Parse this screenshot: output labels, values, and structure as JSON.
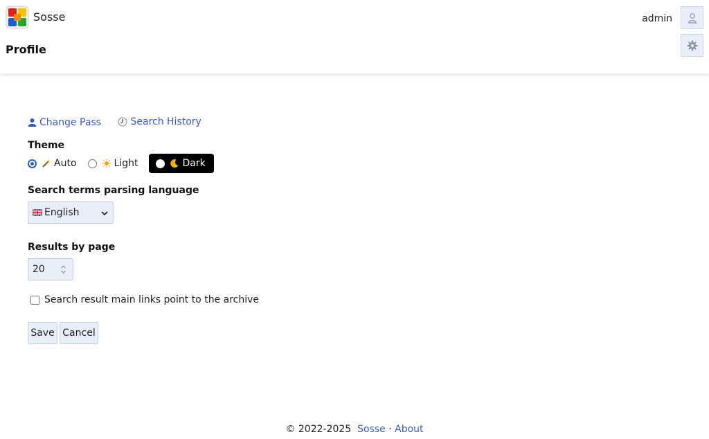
{
  "app": {
    "name": "Sosse"
  },
  "header": {
    "page_title": "Profile",
    "username": "admin",
    "icons": {
      "user": "user-icon",
      "settings": "gear-icon"
    }
  },
  "links": {
    "change_pass": "Change Pass",
    "search_history": "Search History"
  },
  "theme": {
    "label": "Theme",
    "options": [
      {
        "label": "Auto",
        "icon": "magic-wand-icon",
        "selected": true
      },
      {
        "label": "Light",
        "icon": "sun-icon",
        "selected": false
      },
      {
        "label": "Dark",
        "icon": "moon-icon",
        "selected": false
      }
    ]
  },
  "language": {
    "label": "Search terms parsing language",
    "selected": "English",
    "flag": "uk-flag-icon"
  },
  "results": {
    "label": "Results by page",
    "value": "20"
  },
  "archive_links": {
    "label": "Search result main links point to the archive",
    "checked": false
  },
  "buttons": {
    "save": "Save",
    "cancel": "Cancel"
  },
  "footer": {
    "copyright": "© 2022-2025",
    "link1": "Sosse",
    "separator": "·",
    "link2": "About"
  },
  "colors": {
    "link": "#3b5bd6",
    "button_bg": "#e8eefa",
    "accent": "#2a62c9"
  }
}
